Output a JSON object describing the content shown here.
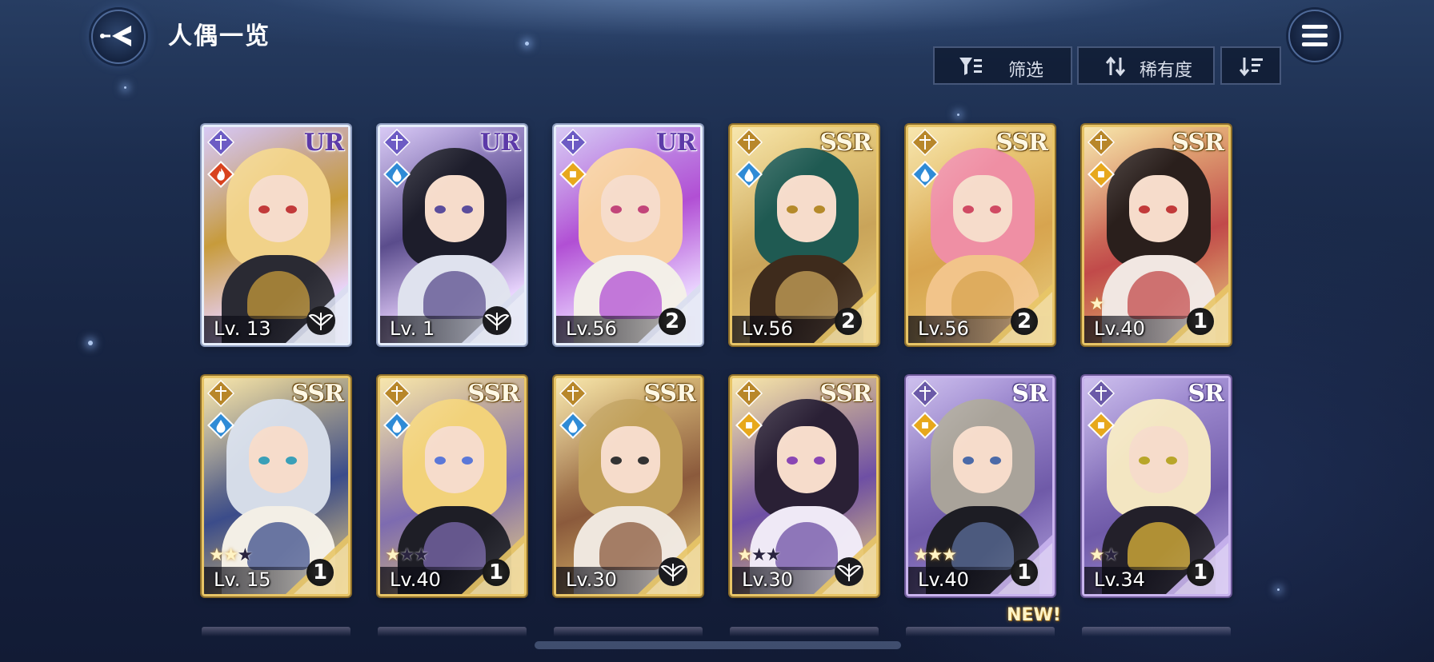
{
  "header": {
    "title": "人偶一览",
    "back_icon": "back-arrow-icon",
    "menu_icon": "hamburger-menu-icon"
  },
  "toolbar": {
    "filter_label": "筛选",
    "filter_icon": "filter-icon",
    "sort_label": "稀有度",
    "sort_icon": "sort-swap-icon",
    "order_icon": "sort-descending-icon"
  },
  "colors": {
    "ur_frame": "#e6eefb",
    "ssr_frame": "#e8c566",
    "sr_frame": "#c9b4ee",
    "element_water": "#2f8bd6",
    "element_fire": "#d8421e",
    "element_light": "#e7a81c"
  },
  "new_label": "NEW!",
  "cards": [
    {
      "rarity": "UR",
      "level": "Lv. 13",
      "element": "fire",
      "stars": 0,
      "star_slots": 0,
      "corner": "emblem",
      "corner_value": "",
      "palette": [
        "#f1d289",
        "#2a2a33",
        "#c79b3b"
      ]
    },
    {
      "rarity": "UR",
      "level": "Lv. 1",
      "element": "water",
      "stars": 0,
      "star_slots": 0,
      "corner": "emblem",
      "corner_value": "",
      "palette": [
        "#1d1d2b",
        "#dfe2ee",
        "#5a4c8c"
      ]
    },
    {
      "rarity": "UR",
      "level": "Lv.56",
      "element": "light",
      "stars": 0,
      "star_slots": 0,
      "corner": "number",
      "corner_value": "2",
      "palette": [
        "#f7cfa0",
        "#f3efe8",
        "#b14fd4"
      ]
    },
    {
      "rarity": "SSR",
      "level": "Lv.56",
      "element": "water",
      "stars": 0,
      "star_slots": 0,
      "corner": "number",
      "corner_value": "2",
      "palette": [
        "#1f5a52",
        "#3e2b1c",
        "#c9a45a"
      ]
    },
    {
      "rarity": "SSR",
      "level": "Lv.56",
      "element": "water",
      "stars": 0,
      "star_slots": 0,
      "corner": "number",
      "corner_value": "2",
      "palette": [
        "#ef8fa4",
        "#f2c48a",
        "#d7a44f"
      ]
    },
    {
      "rarity": "SSR",
      "level": "Lv.40",
      "element": "light",
      "stars": 1,
      "star_slots": 1,
      "corner": "number",
      "corner_value": "1",
      "palette": [
        "#2a1f1c",
        "#f1e7e2",
        "#c14a4a"
      ]
    },
    {
      "rarity": "SSR",
      "level": "Lv. 15",
      "element": "water",
      "stars": 2,
      "star_slots": 3,
      "corner": "number",
      "corner_value": "1",
      "palette": [
        "#d5dce8",
        "#f3efe6",
        "#3b4c8a"
      ]
    },
    {
      "rarity": "SSR",
      "level": "Lv.40",
      "element": "water",
      "stars": 1,
      "star_slots": 3,
      "corner": "number",
      "corner_value": "1",
      "palette": [
        "#f2d27a",
        "#1e1e26",
        "#7d6bb0"
      ]
    },
    {
      "rarity": "SSR",
      "level": "Lv.30",
      "element": "water",
      "stars": 0,
      "star_slots": 0,
      "corner": "emblem",
      "corner_value": "",
      "palette": [
        "#c1a05a",
        "#efe7de",
        "#8b5a3c"
      ]
    },
    {
      "rarity": "SSR",
      "level": "Lv.30",
      "element": "light",
      "stars": 1,
      "star_slots": 3,
      "corner": "emblem",
      "corner_value": "",
      "palette": [
        "#2a2035",
        "#efe9f6",
        "#6e4fa4"
      ]
    },
    {
      "rarity": "SR",
      "level": "Lv.40",
      "element": "light",
      "stars": 3,
      "star_slots": 3,
      "corner": "number",
      "corner_value": "1",
      "palette": [
        "#a9a39a",
        "#1d1d24",
        "#5c6f9c"
      ]
    },
    {
      "rarity": "SR",
      "level": "Lv.34",
      "element": "light",
      "stars": 1,
      "star_slots": 2,
      "corner": "number",
      "corner_value": "1",
      "palette": [
        "#f3e6c2",
        "#23202a",
        "#e0b63a"
      ]
    }
  ]
}
